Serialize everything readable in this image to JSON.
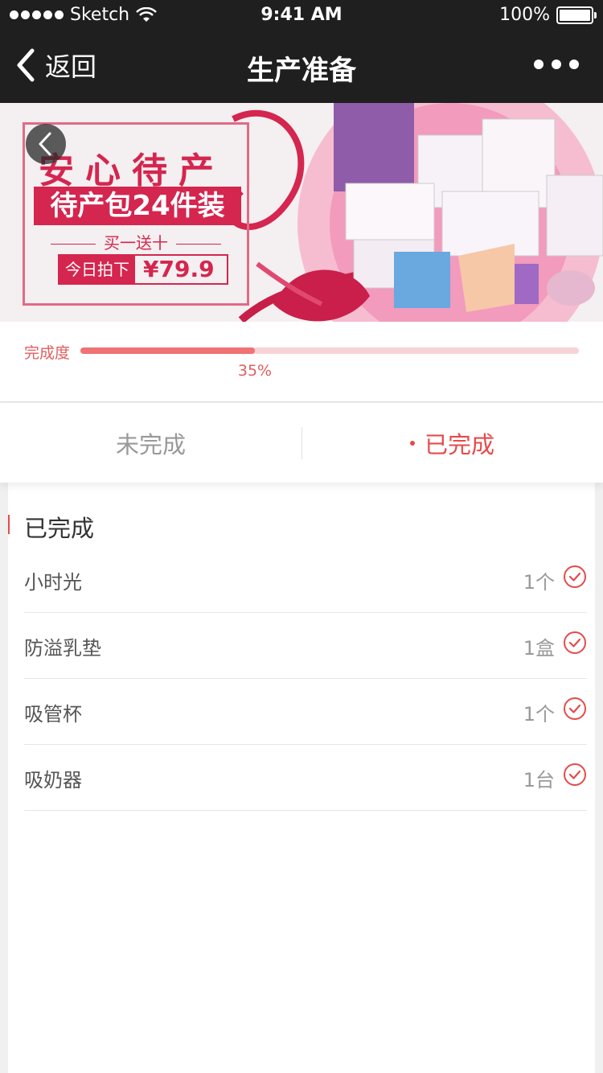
{
  "status_bar": {
    "carrier": "Sketch",
    "time": "9:41 AM",
    "battery": "100%"
  },
  "nav": {
    "back_label": "返回",
    "title": "生产准备"
  },
  "banner": {
    "title": "安心待产",
    "subtitle": "待产包24件装",
    "gift": "买一送十",
    "price_label": "今日拍下",
    "price_value": "¥79.9"
  },
  "progress": {
    "label": "完成度",
    "percent": 35,
    "percent_text": "35%"
  },
  "tabs": [
    {
      "label": "未完成",
      "active": false
    },
    {
      "label": "已完成",
      "active": true
    }
  ],
  "list": {
    "heading": "已完成",
    "items": [
      {
        "name": "小时光",
        "qty": "1个",
        "done": true
      },
      {
        "name": "防溢乳垫",
        "qty": "1盒",
        "done": true
      },
      {
        "name": "吸管杯",
        "qty": "1个",
        "done": true
      },
      {
        "name": "吸奶器",
        "qty": "1台",
        "done": true
      }
    ]
  },
  "colors": {
    "accent": "#e54b4b",
    "nav_bg": "#1f1f1f",
    "progress_fill": "#f07275",
    "progress_track": "#f7d3d5"
  }
}
